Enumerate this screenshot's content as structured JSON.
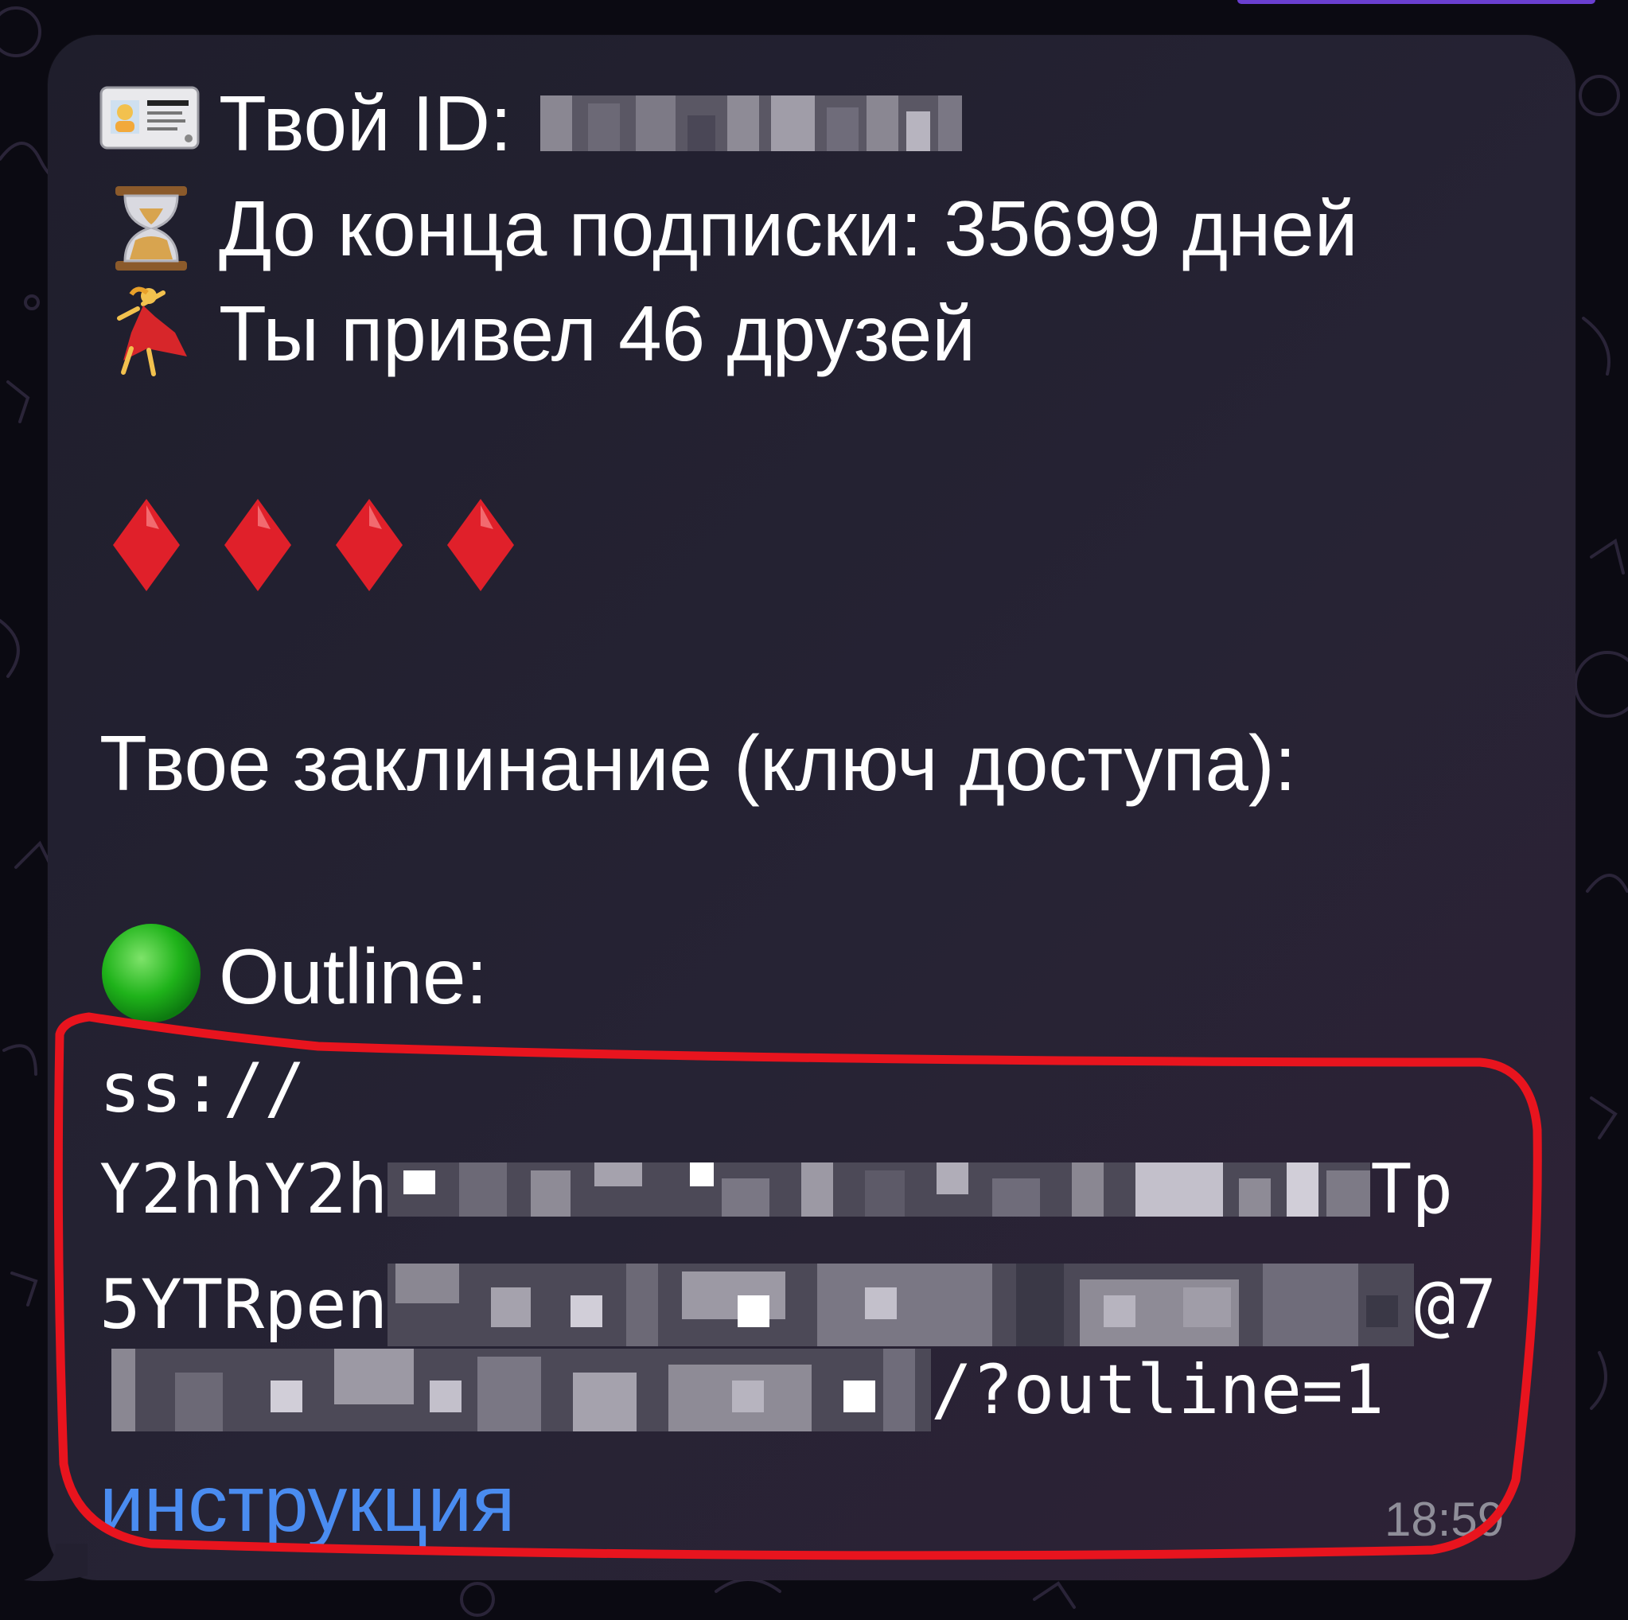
{
  "message": {
    "id_label": "Твой ID:",
    "id_value_redacted": true,
    "subscription_text": "До конца подписки: 35699 дней",
    "friends_text": "Ты привел 46 друзей",
    "key_heading": "Твое заклинание (ключ доступа):",
    "outline_label": "Outline:",
    "key_line_1": "ss://",
    "key_line_2_start": "Y2hhY2h",
    "key_line_2_end": "Tp",
    "key_line_3_start": "5YTRpen",
    "key_line_3_end": "@7",
    "key_line_4_end": "/?outline=1",
    "instruction_link": "инструкция",
    "timestamp": "18:59"
  },
  "icons": {
    "id_card": "id-card-icon",
    "hourglass": "hourglass-icon",
    "dancer": "dancer-icon",
    "diamond": "red-diamond-icon",
    "green_circle": "green-circle-icon"
  },
  "colors": {
    "bubble_bg": "#262334",
    "link": "#4a8cf0",
    "annotation_stroke": "#e8141e",
    "diamond": "#e0202a",
    "green_circle": "#1fb31a",
    "timestamp": "#8f8e99"
  }
}
